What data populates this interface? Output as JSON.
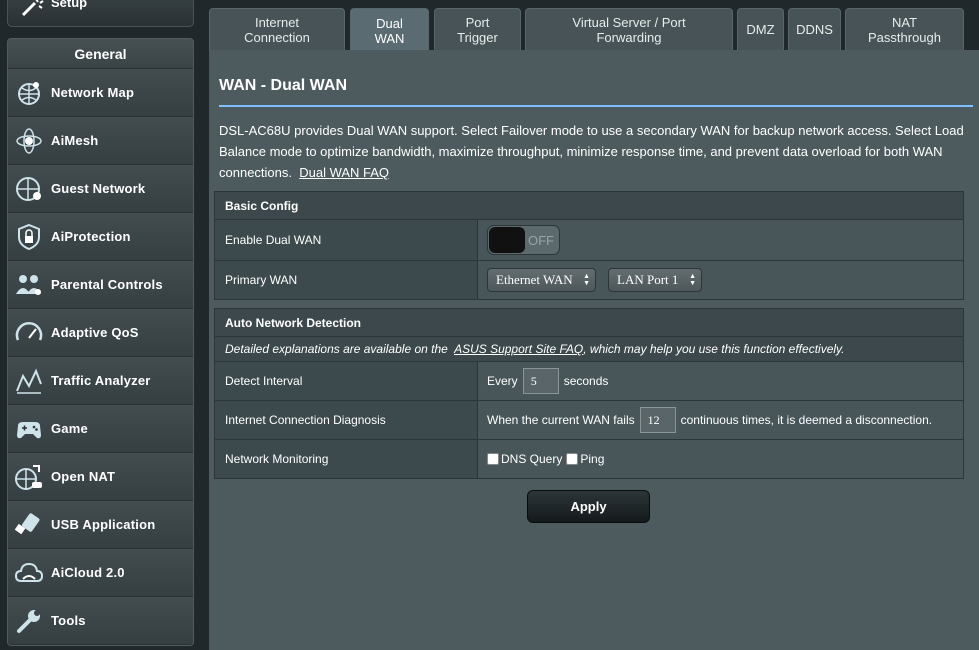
{
  "sidebar": {
    "setup_label": "Setup",
    "general_title": "General",
    "items": [
      {
        "label": "Network Map",
        "icon": "network-map-icon"
      },
      {
        "label": "AiMesh",
        "icon": "aimesh-icon"
      },
      {
        "label": "Guest Network",
        "icon": "guest-network-icon"
      },
      {
        "label": "AiProtection",
        "icon": "shield-icon"
      },
      {
        "label": "Parental Controls",
        "icon": "family-icon"
      },
      {
        "label": "Adaptive QoS",
        "icon": "speedometer-icon"
      },
      {
        "label": "Traffic Analyzer",
        "icon": "traffic-chart-icon"
      },
      {
        "label": "Game",
        "icon": "gamepad-icon"
      },
      {
        "label": "Open NAT",
        "icon": "open-nat-icon"
      },
      {
        "label": "USB Application",
        "icon": "usb-icon"
      },
      {
        "label": "AiCloud 2.0",
        "icon": "cloud-icon"
      },
      {
        "label": "Tools",
        "icon": "wrench-icon"
      }
    ]
  },
  "tabs": [
    {
      "l1": "Internet",
      "l2": "Connection"
    },
    {
      "l1": "Dual",
      "l2": "WAN"
    },
    {
      "l1": "Port",
      "l2": "Trigger"
    },
    {
      "l1": "Virtual Server / Port",
      "l2": "Forwarding"
    },
    {
      "l1": "DMZ",
      "l2": ""
    },
    {
      "l1": "DDNS",
      "l2": ""
    },
    {
      "l1": "NAT",
      "l2": "Passthrough"
    }
  ],
  "main": {
    "title": "WAN - Dual WAN",
    "description": "DSL-AC68U provides Dual WAN support. Select Failover mode to use a secondary WAN for backup network access. Select Load Balance mode to optimize bandwidth, maximize throughput, minimize response time, and prevent data overload for both WAN connections.",
    "faq_link": "Dual WAN FAQ",
    "basic_config": {
      "header": "Basic Config",
      "enable_label": "Enable Dual WAN",
      "enable_state": "OFF",
      "primary_label": "Primary WAN",
      "primary_wan": "Ethernet WAN",
      "primary_port": "LAN Port 1"
    },
    "auto_detect": {
      "header": "Auto Network Detection",
      "note_pre": "Detailed explanations are available on the",
      "note_link": "ASUS Support Site FAQ",
      "note_post": ", which may help you use this function effectively.",
      "detect_label": "Detect Interval",
      "detect_pre": "Every",
      "detect_value": "5",
      "detect_post": "seconds",
      "diag_label": "Internet Connection Diagnosis",
      "diag_pre": "When the current WAN fails",
      "diag_value": "12",
      "diag_post": "continuous times, it is deemed a disconnection.",
      "monitor_label": "Network Monitoring",
      "dns_label": "DNS Query",
      "ping_label": "Ping"
    },
    "apply_label": "Apply"
  },
  "colors": {
    "accent_line": "#7bc0ff",
    "panel": "#4d5b5f",
    "background": "#20282b"
  }
}
